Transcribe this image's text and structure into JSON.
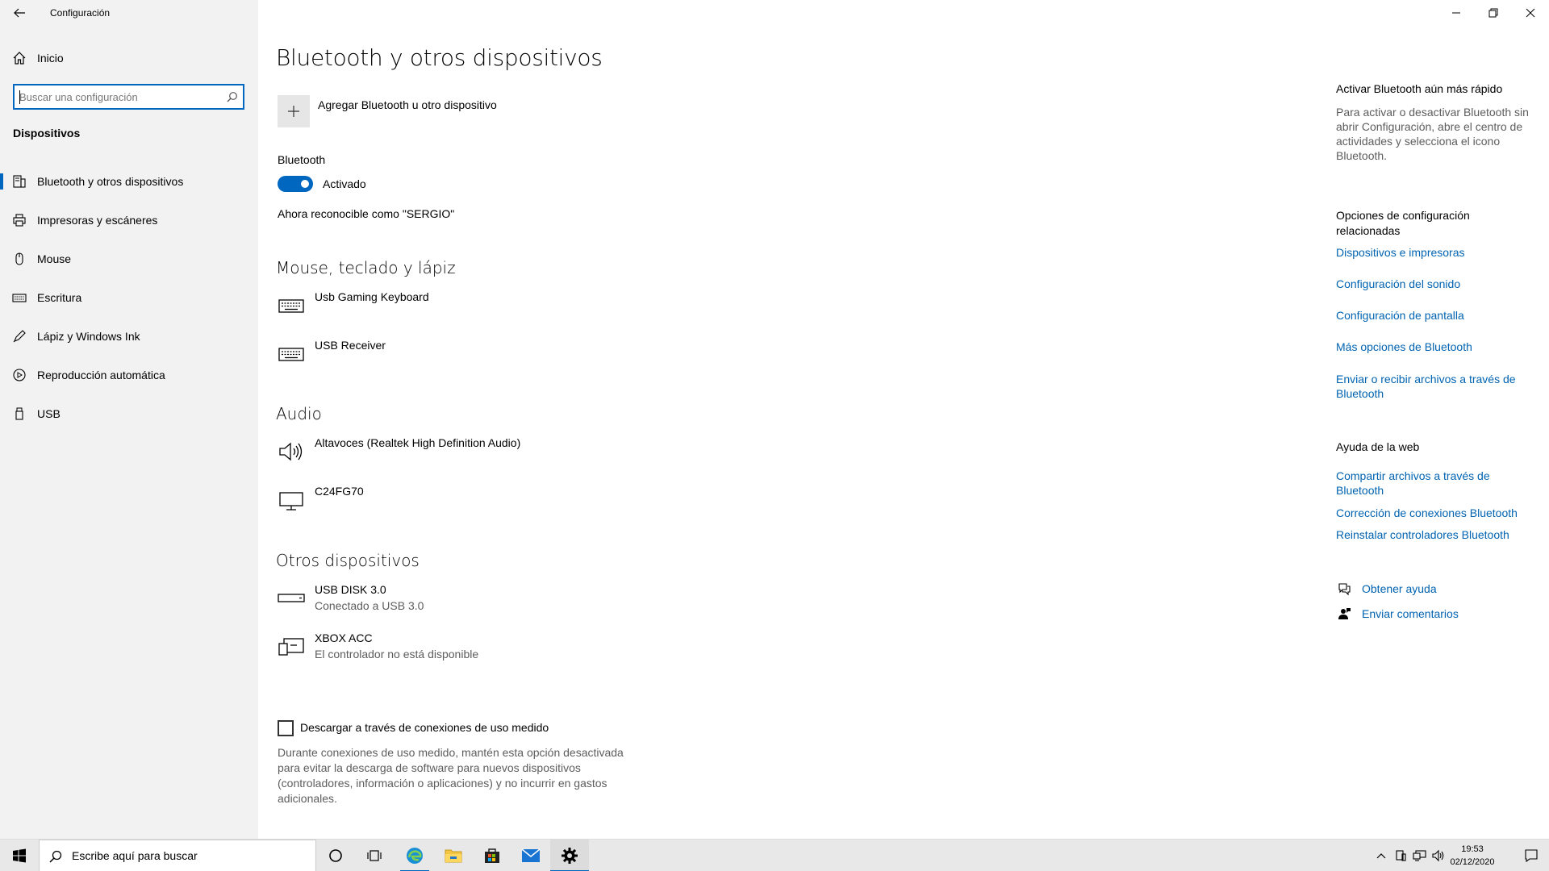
{
  "window": {
    "title": "Configuración"
  },
  "sidebar": {
    "home_label": "Inicio",
    "search_placeholder": "Buscar una configuración",
    "section_title": "Dispositivos",
    "items": [
      {
        "label": "Bluetooth y otros dispositivos",
        "icon": "bluetooth-devices-icon",
        "selected": true
      },
      {
        "label": "Impresoras y escáneres",
        "icon": "printer-icon"
      },
      {
        "label": "Mouse",
        "icon": "mouse-icon"
      },
      {
        "label": "Escritura",
        "icon": "keyboard-icon"
      },
      {
        "label": "Lápiz y Windows Ink",
        "icon": "pen-icon"
      },
      {
        "label": "Reproducción automática",
        "icon": "autoplay-icon"
      },
      {
        "label": "USB",
        "icon": "usb-icon"
      }
    ]
  },
  "main": {
    "title": "Bluetooth y otros dispositivos",
    "add_device_label": "Agregar Bluetooth u otro dispositivo",
    "bluetooth_label": "Bluetooth",
    "bluetooth_state": "Activado",
    "discoverable": "Ahora reconocible como \"SERGIO\"",
    "sections": {
      "mouse": {
        "title": "Mouse, teclado y lápiz",
        "devices": [
          {
            "name": "Usb Gaming Keyboard",
            "icon": "keyboard-icon"
          },
          {
            "name": "USB Receiver",
            "icon": "keyboard-icon"
          }
        ]
      },
      "audio": {
        "title": "Audio",
        "devices": [
          {
            "name": "Altavoces (Realtek High Definition Audio)",
            "icon": "speaker-icon"
          },
          {
            "name": "C24FG70",
            "icon": "monitor-icon"
          }
        ]
      },
      "other": {
        "title": "Otros dispositivos",
        "devices": [
          {
            "name": "USB DISK 3.0",
            "status": "Conectado a USB 3.0",
            "icon": "usb-drive-icon"
          },
          {
            "name": "XBOX ACC",
            "status": "El controlador no está disponible",
            "icon": "generic-device-icon"
          }
        ]
      }
    },
    "metered_label": "Descargar a través de conexiones de uso medido",
    "metered_checked": false,
    "metered_desc": "Durante conexiones de uso medido, mantén esta opción desactivada para evitar la descarga de software para nuevos dispositivos (controladores, información o aplicaciones) y no incurrir en gastos adicionales."
  },
  "right_panel": {
    "tip_title": "Activar Bluetooth aún más rápido",
    "tip_text": "Para activar o desactivar Bluetooth sin abrir Configuración, abre el centro de actividades y selecciona el icono Bluetooth.",
    "related_title": "Opciones de configuración relacionadas",
    "related_links": [
      "Dispositivos e impresoras",
      "Configuración del sonido",
      "Configuración de pantalla",
      "Más opciones de Bluetooth",
      "Enviar o recibir archivos a través de Bluetooth"
    ],
    "web_title": "Ayuda de la web",
    "web_links": [
      "Compartir archivos a través de Bluetooth",
      "Corrección de conexiones Bluetooth",
      "Reinstalar controladores Bluetooth"
    ],
    "get_help": "Obtener ayuda",
    "feedback": "Enviar comentarios"
  },
  "taskbar": {
    "search_placeholder": "Escribe aquí para buscar",
    "time": "19:53",
    "date": "02/12/2020",
    "accent_color": "#0067c0"
  }
}
